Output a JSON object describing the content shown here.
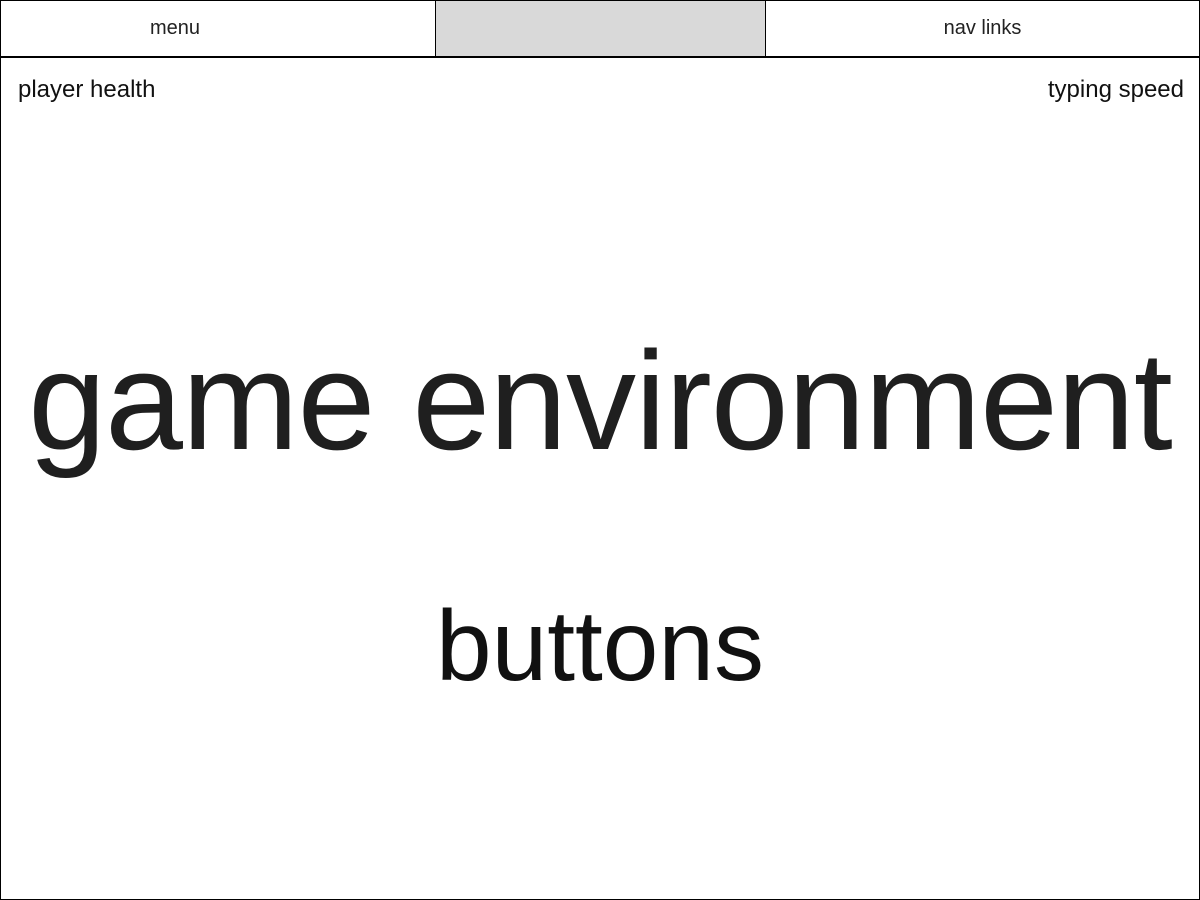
{
  "header": {
    "menu_label": "menu",
    "nav_label": "nav links",
    "slot_color": "#d9d9d9"
  },
  "hud": {
    "player_health_label": "player health",
    "typing_speed_label": "typing speed"
  },
  "main": {
    "game_environment_label": "game environment",
    "buttons_label": "buttons"
  }
}
